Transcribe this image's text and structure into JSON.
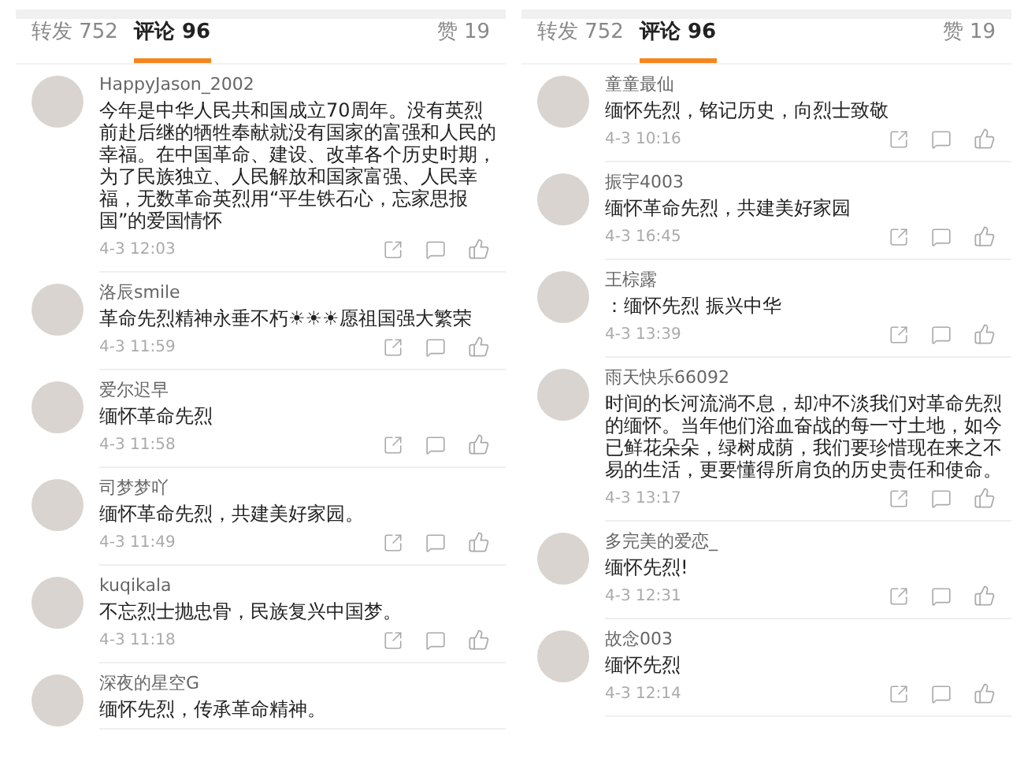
{
  "panels": [
    {
      "tabs": [
        {
          "label": "转发 752",
          "selected": false
        },
        {
          "label": "评论 96",
          "selected": true
        }
      ],
      "likes_tab": {
        "label": "赞 19",
        "selected": false
      },
      "comments": [
        {
          "user": "HappyJason_2002",
          "text": "今年是中华人民共和国成立70周年。没有英烈前赴后继的牺牲奉献就没有国家的富强和人民的幸福。在中国革命、建设、改革各个历史时期，为了民族独立、人民解放和国家富强、人民幸福，无数革命英烈用“平生铁石心，忘家思报国”的爱国情怀",
          "time": "4-3 12:03"
        },
        {
          "user": "洛辰smile",
          "text": "革命先烈精神永垂不朽☀☀☀愿祖国强大繁荣",
          "time": "4-3 11:59"
        },
        {
          "user": "爱尔迟早",
          "text": "缅怀革命先烈",
          "time": "4-3 11:58"
        },
        {
          "user": "司梦梦吖",
          "text": "缅怀革命先烈，共建美好家园。",
          "time": "4-3 11:49"
        },
        {
          "user": "kuqikala",
          "text": "不忘烈士抛忠骨，民族复兴中国梦。",
          "time": "4-3 11:18"
        },
        {
          "user": "深夜的星空G",
          "text": "缅怀先烈，传承革命精神。"
        }
      ]
    },
    {
      "tabs": [
        {
          "label": "转发 752",
          "selected": false
        },
        {
          "label": "评论 96",
          "selected": true
        }
      ],
      "likes_tab": {
        "label": "赞 19",
        "selected": false
      },
      "comments": [
        {
          "user": "童童最仙",
          "text": "缅怀先烈，铭记历史，向烈士致敬",
          "time": "4-3 10:16"
        },
        {
          "user": "振宇4003",
          "text": "缅怀革命先烈，共建美好家园",
          "time": "4-3 16:45"
        },
        {
          "user": "王棕露",
          "text": "：缅怀先烈  振兴中华",
          "time": "4-3 13:39"
        },
        {
          "user": "雨天快乐66092",
          "text": "时间的长河流淌不息，却冲不淡我们对革命先烈的缅怀。当年他们浴血奋战的每一寸土地，如今已鲜花朵朵，绿树成荫，我们要珍惜现在来之不易的生活，更要懂得所肩负的历史责任和使命。",
          "time": "4-3 13:17"
        },
        {
          "user": "多完美的爱恋_",
          "text": "缅怀先烈!",
          "time": "4-3 12:31"
        },
        {
          "user": "故念003",
          "text": "缅怀先烈",
          "time": "4-3 12:14"
        }
      ]
    }
  ]
}
